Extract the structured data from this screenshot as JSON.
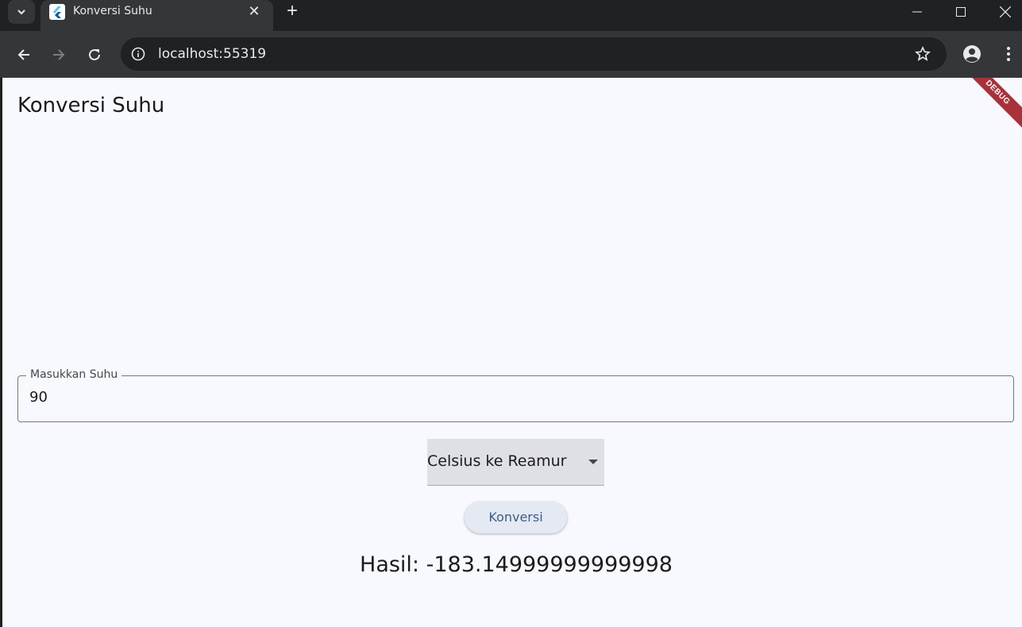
{
  "browser": {
    "tab_title": "Konversi Suhu",
    "tab_close": "✕",
    "new_tab": "+",
    "url": "localhost:55319"
  },
  "app": {
    "title": "Konversi Suhu",
    "debug_label": "DEBUG",
    "input": {
      "label": "Masukkan Suhu",
      "value": "90"
    },
    "dropdown": {
      "selected": "Celsius ke Reamur"
    },
    "convert_button": "Konversi",
    "result": "Hasil: -183.14999999999998"
  },
  "colors": {
    "page_bg": "#f8f9ff",
    "debug_banner": "#a8313a",
    "button_text": "#385f8f"
  }
}
